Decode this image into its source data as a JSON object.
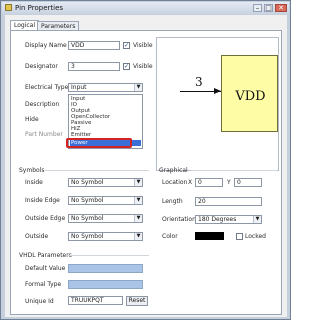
{
  "window": {
    "title": "Pin Properties",
    "minimize": "–",
    "maximize": "□",
    "close": "✕"
  },
  "tabs": [
    "Logical",
    "Parameters"
  ],
  "logical": {
    "display_name_label": "Display Name",
    "display_name_value": "VDD",
    "visible_label": "Visible",
    "designator_label": "Designator",
    "designator_value": "3",
    "electrical_type_label": "Electrical Type",
    "electrical_type_value": "Input",
    "description_label": "Description",
    "hide_label": "Hide",
    "part_number_label": "Part Number"
  },
  "electrical_options": [
    "Input",
    "IO",
    "Output",
    "OpenCollector",
    "Passive",
    "HiZ",
    "Emitter",
    "Power"
  ],
  "selected_option": "Power",
  "symbols": {
    "title": "Symbols",
    "inside_label": "Inside",
    "inside_value": "No Symbol",
    "inside_edge_label": "Inside Edge",
    "inside_edge_value": "No Symbol",
    "outside_edge_label": "Outside Edge",
    "outside_edge_value": "No Symbol",
    "outside_label": "Outside",
    "outside_value": "No Symbol"
  },
  "graphical": {
    "title": "Graphical",
    "location_label": "Location",
    "x_label": "X",
    "x_value": "0",
    "y_label": "Y",
    "y_value": "0",
    "length_label": "Length",
    "length_value": "20",
    "orientation_label": "Orientation",
    "orientation_value": "180 Degrees",
    "color_label": "Color",
    "color_value": "#000000",
    "locked_label": "Locked"
  },
  "vhdl": {
    "title": "VHDL Parameters",
    "default_value_label": "Default Value",
    "formal_type_label": "Formal Type",
    "unique_id_label": "Unique Id",
    "unique_id_value": "TRUUKPQT",
    "reset_label": "Reset"
  },
  "preview": {
    "pin_number": "3",
    "pin_name": "VDD"
  },
  "colors": {
    "body_fill": "#fffca6",
    "highlight": "#d42323",
    "selection": "#3a6fd8"
  }
}
